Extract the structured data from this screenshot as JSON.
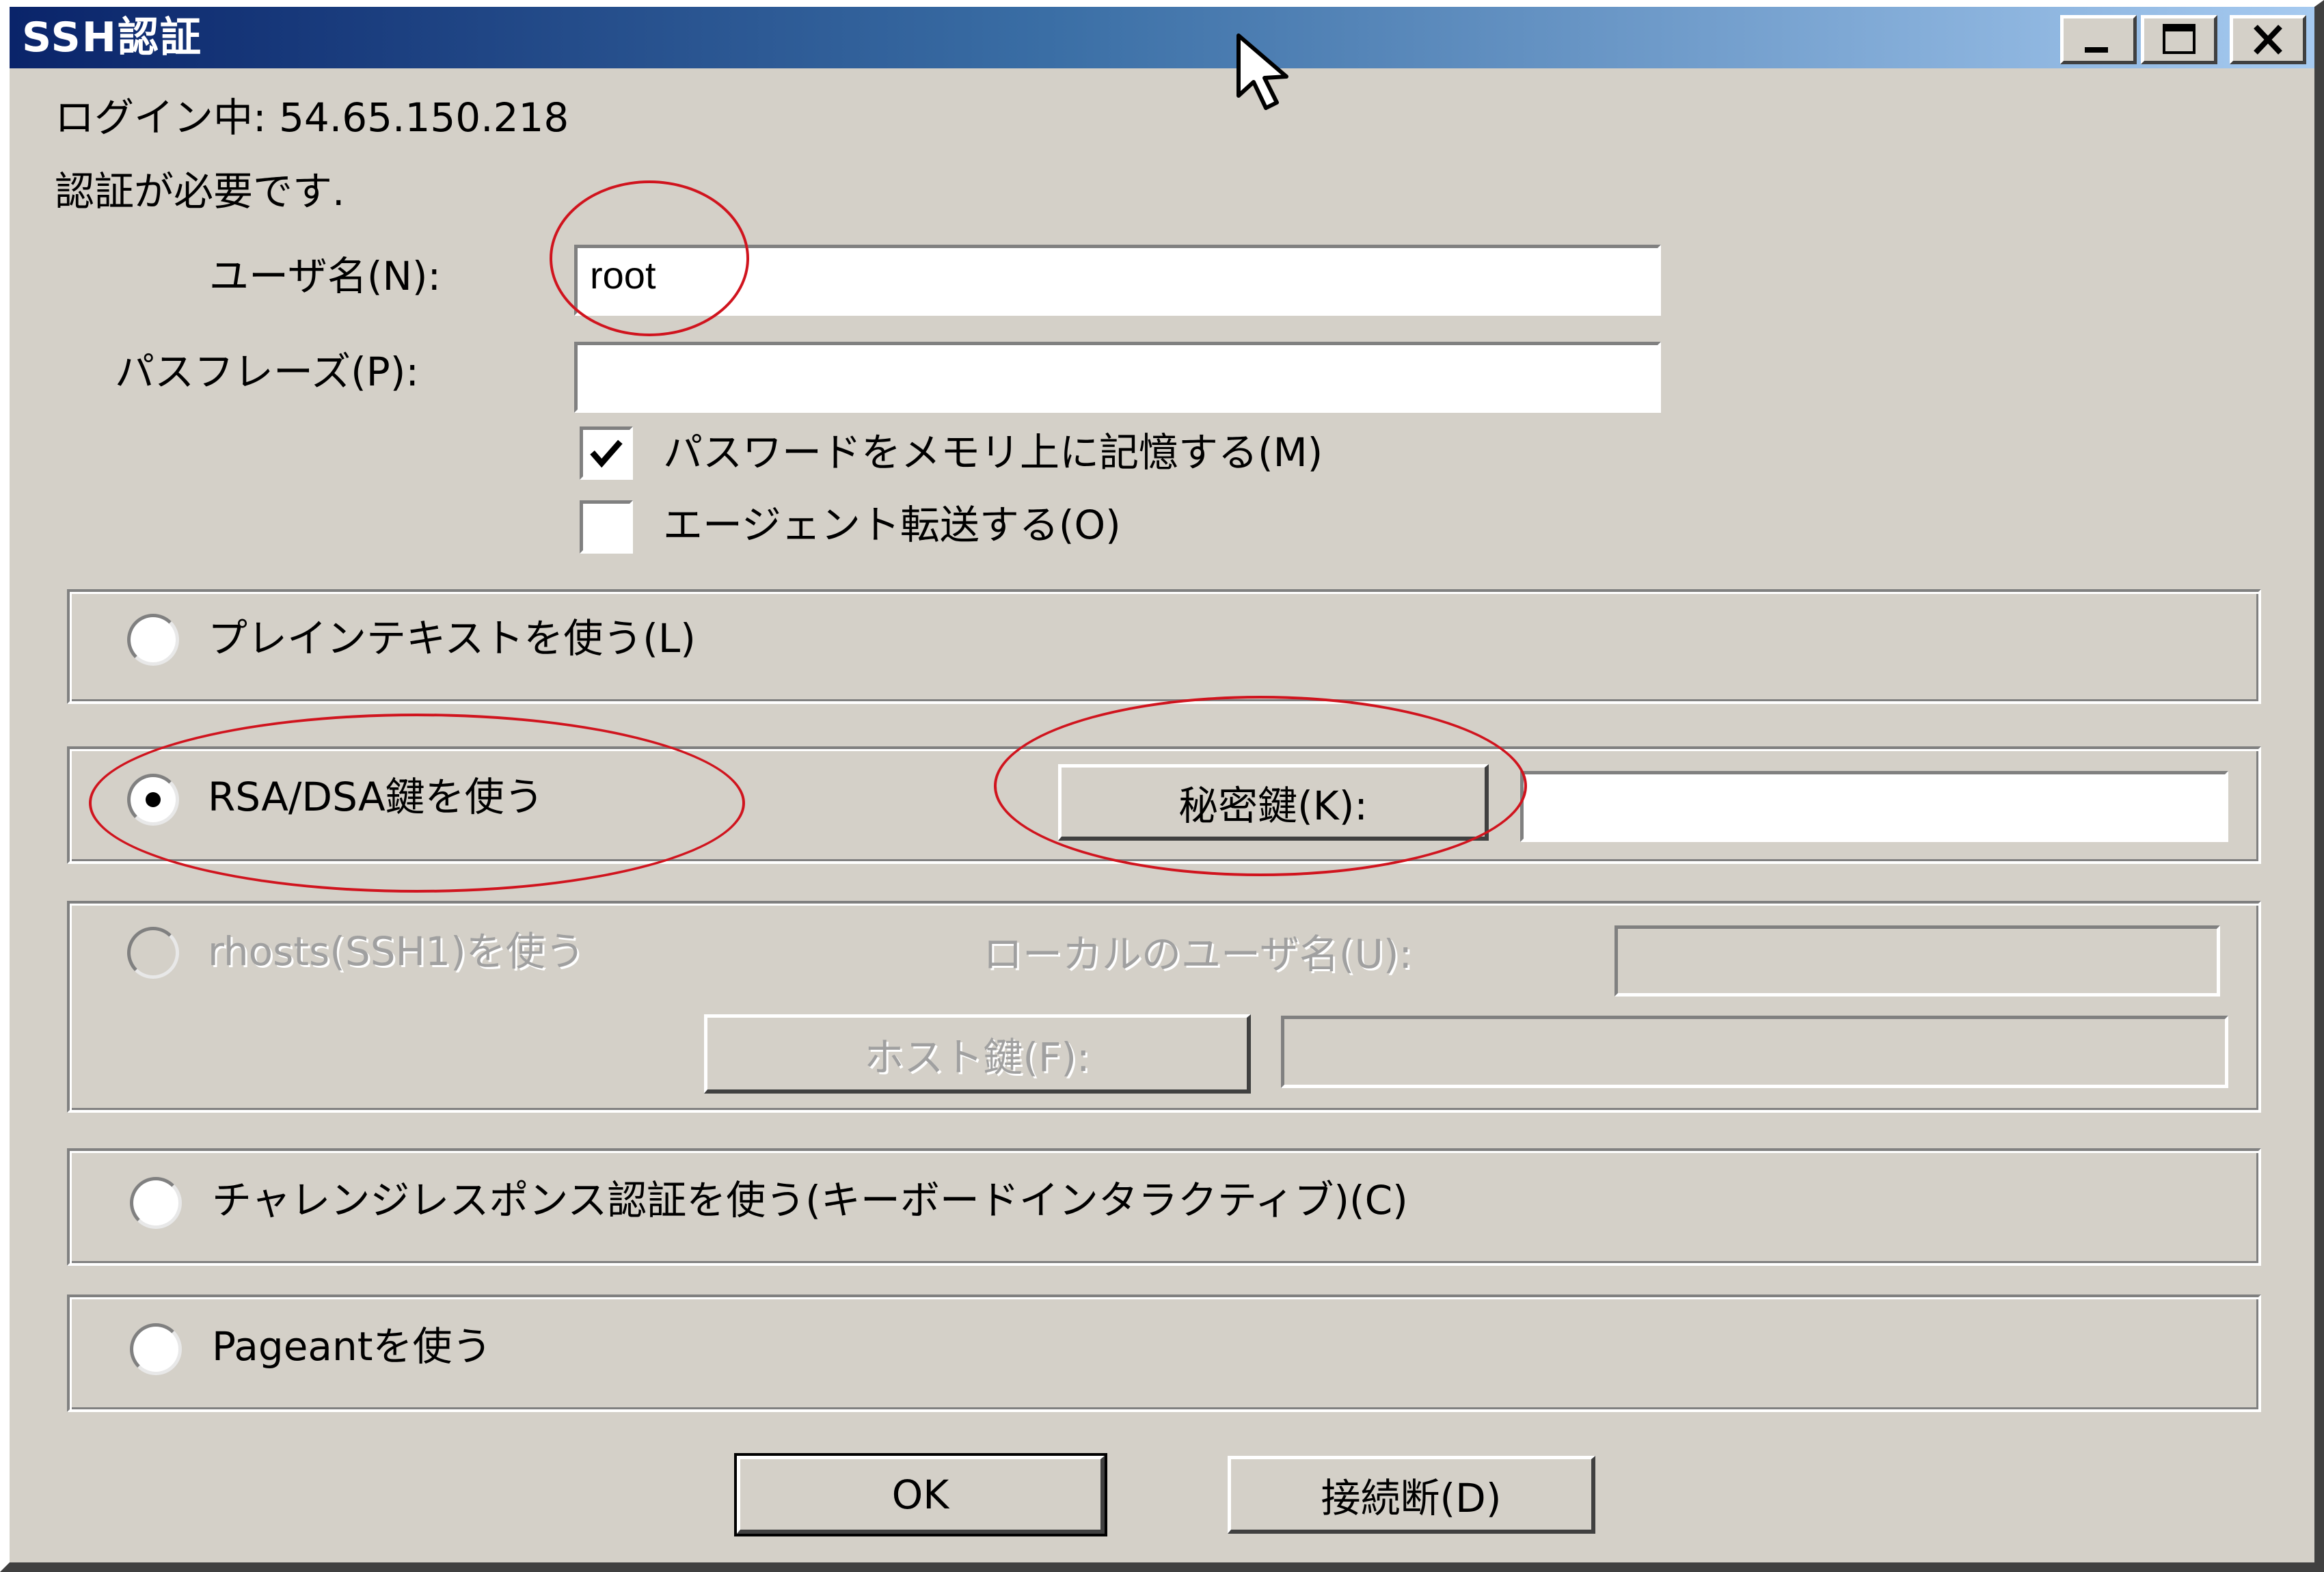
{
  "window": {
    "title": "SSH認証",
    "controls": [
      "minimize-icon",
      "maximize-icon",
      "close-icon"
    ]
  },
  "status": {
    "login_line": "ログイン中: 54.65.150.218",
    "auth_required": "認証が必要です."
  },
  "form": {
    "username_label": "ユーザ名(N):",
    "username_value": "root",
    "passphrase_label": "パスフレーズ(P):",
    "passphrase_value": "",
    "remember_label": "パスワードをメモリ上に記憶する(M)",
    "remember_checked": true,
    "agent_label": "エージェント転送する(O)",
    "agent_checked": false
  },
  "methods": {
    "plaintext_label": "プレインテキストを使う(L)",
    "rsa_label": "RSA/DSA鍵を使う",
    "private_key_button": "秘密鍵(K):",
    "private_key_value": "",
    "rhosts_label": "rhosts(SSH1)を使う",
    "local_user_label": "ローカルのユーザ名(U):",
    "host_key_button": "ホスト鍵(F):",
    "challenge_label": "チャレンジレスポンス認証を使う(キーボードインタラクティブ)(C)",
    "pageant_label": "Pageantを使う",
    "selected": "rsa"
  },
  "buttons": {
    "ok": "OK",
    "disconnect": "接続断(D)"
  },
  "colors": {
    "annotation": "#d0141e",
    "title_gradient_start": "#0a246a",
    "title_gradient_end": "#a6caf0",
    "dialog_bg": "#d4d0c8"
  }
}
